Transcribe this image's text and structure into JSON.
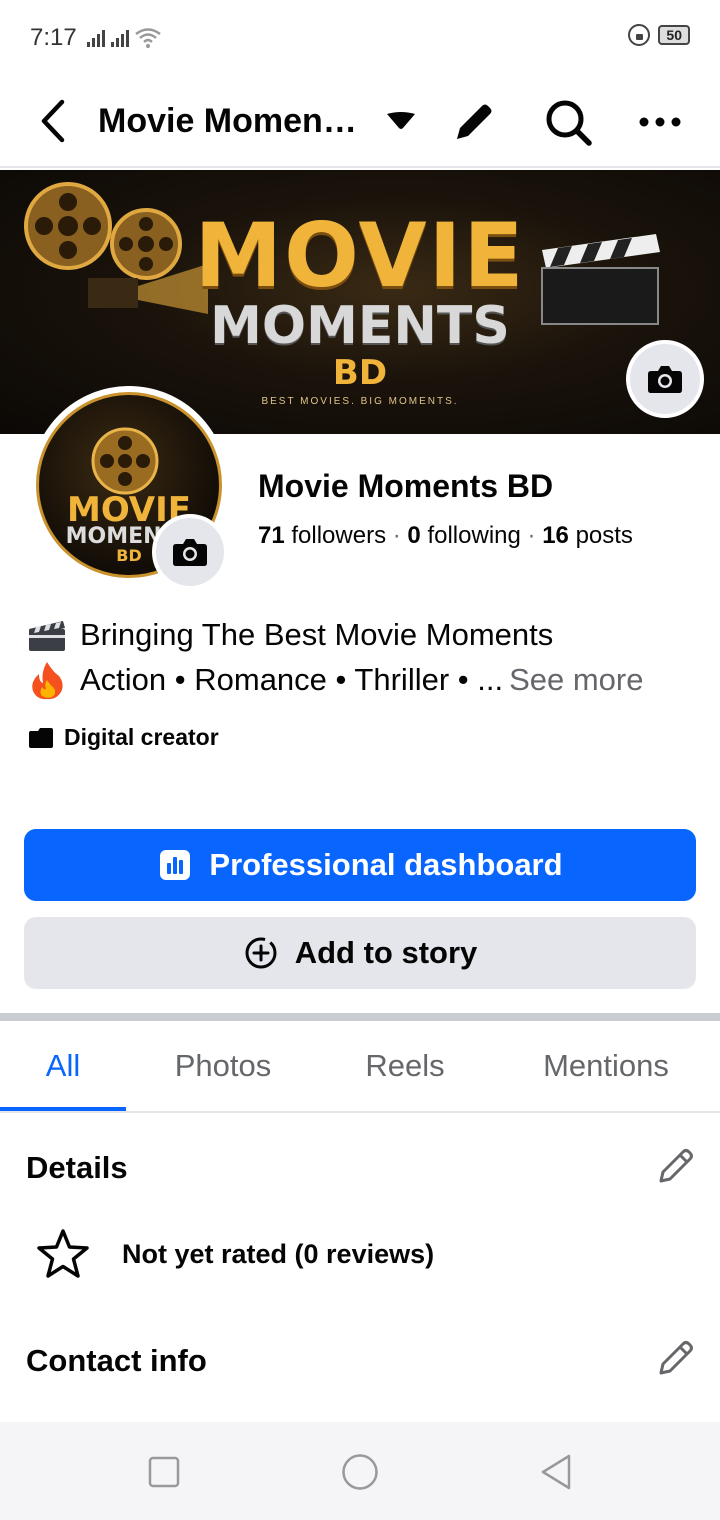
{
  "status": {
    "time": "7:17",
    "battery": "50"
  },
  "header": {
    "title": "Movie Moments BD"
  },
  "cover": {
    "line1": "MOVIE",
    "line2": "MOMENTS",
    "line3": "BD",
    "tagline": "BEST MOVIES. BIG MOMENTS."
  },
  "avatar": {
    "line1": "MOVIE",
    "line2": "MOMENTS",
    "line3": "BD"
  },
  "profile": {
    "name": "Movie Moments BD",
    "followers_count": "71",
    "followers_label": "followers",
    "following_count": "0",
    "following_label": "following",
    "posts_count": "16",
    "posts_label": "posts",
    "separator": "·"
  },
  "bio": {
    "line1": "Bringing The Best Movie Moments",
    "line2": "Action • Romance • Thriller • ...",
    "see_more": "See more"
  },
  "category": "Digital creator",
  "buttons": {
    "dashboard": "Professional dashboard",
    "add_story": "Add to story"
  },
  "tabs": [
    "All",
    "Photos",
    "Reels",
    "Mentions"
  ],
  "details": {
    "title": "Details",
    "rating": "Not yet rated (0 reviews)"
  },
  "contact": {
    "title": "Contact info"
  },
  "colors": {
    "accent": "#0866ff",
    "secondary_button": "#e4e6eb",
    "muted_text": "#65676b"
  },
  "icons": [
    "back-arrow-icon",
    "caret-down-icon",
    "pencil-icon",
    "search-icon",
    "more-icon",
    "camera-icon",
    "clapper-icon",
    "fire-icon",
    "video-badge-icon",
    "dashboard-icon",
    "plus-circle-icon",
    "star-icon",
    "square-icon",
    "circle-icon",
    "triangle-back-icon"
  ]
}
